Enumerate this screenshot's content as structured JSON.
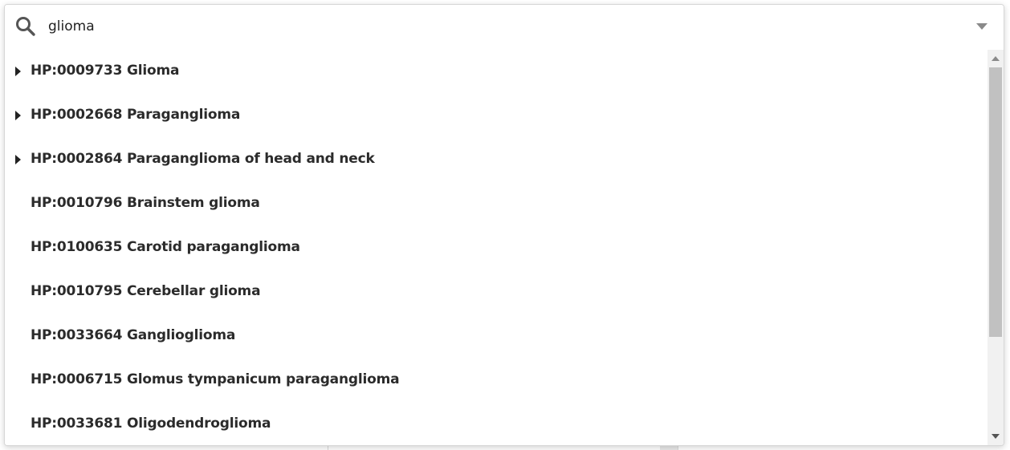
{
  "search": {
    "value": "glioma",
    "placeholder": ""
  },
  "results": [
    {
      "label": "HP:0009733 Glioma",
      "expandable": true
    },
    {
      "label": "HP:0002668 Paraganglioma",
      "expandable": true
    },
    {
      "label": "HP:0002864 Paraganglioma of head and neck",
      "expandable": true
    },
    {
      "label": "HP:0010796 Brainstem glioma",
      "expandable": false
    },
    {
      "label": "HP:0100635 Carotid paraganglioma",
      "expandable": false
    },
    {
      "label": "HP:0010795 Cerebellar glioma",
      "expandable": false
    },
    {
      "label": "HP:0033664 Ganglioglioma",
      "expandable": false
    },
    {
      "label": "HP:0006715 Glomus tympanicum paraganglioma",
      "expandable": false
    },
    {
      "label": "HP:0033681 Oligodendroglioma",
      "expandable": false
    }
  ],
  "icons": {
    "search": "search-icon",
    "dropdown": "chevron-down-icon",
    "expand": "caret-right-icon"
  },
  "colors": {
    "text": "#2b2b2b",
    "icon": "#555555",
    "border": "#d6d6d6"
  }
}
